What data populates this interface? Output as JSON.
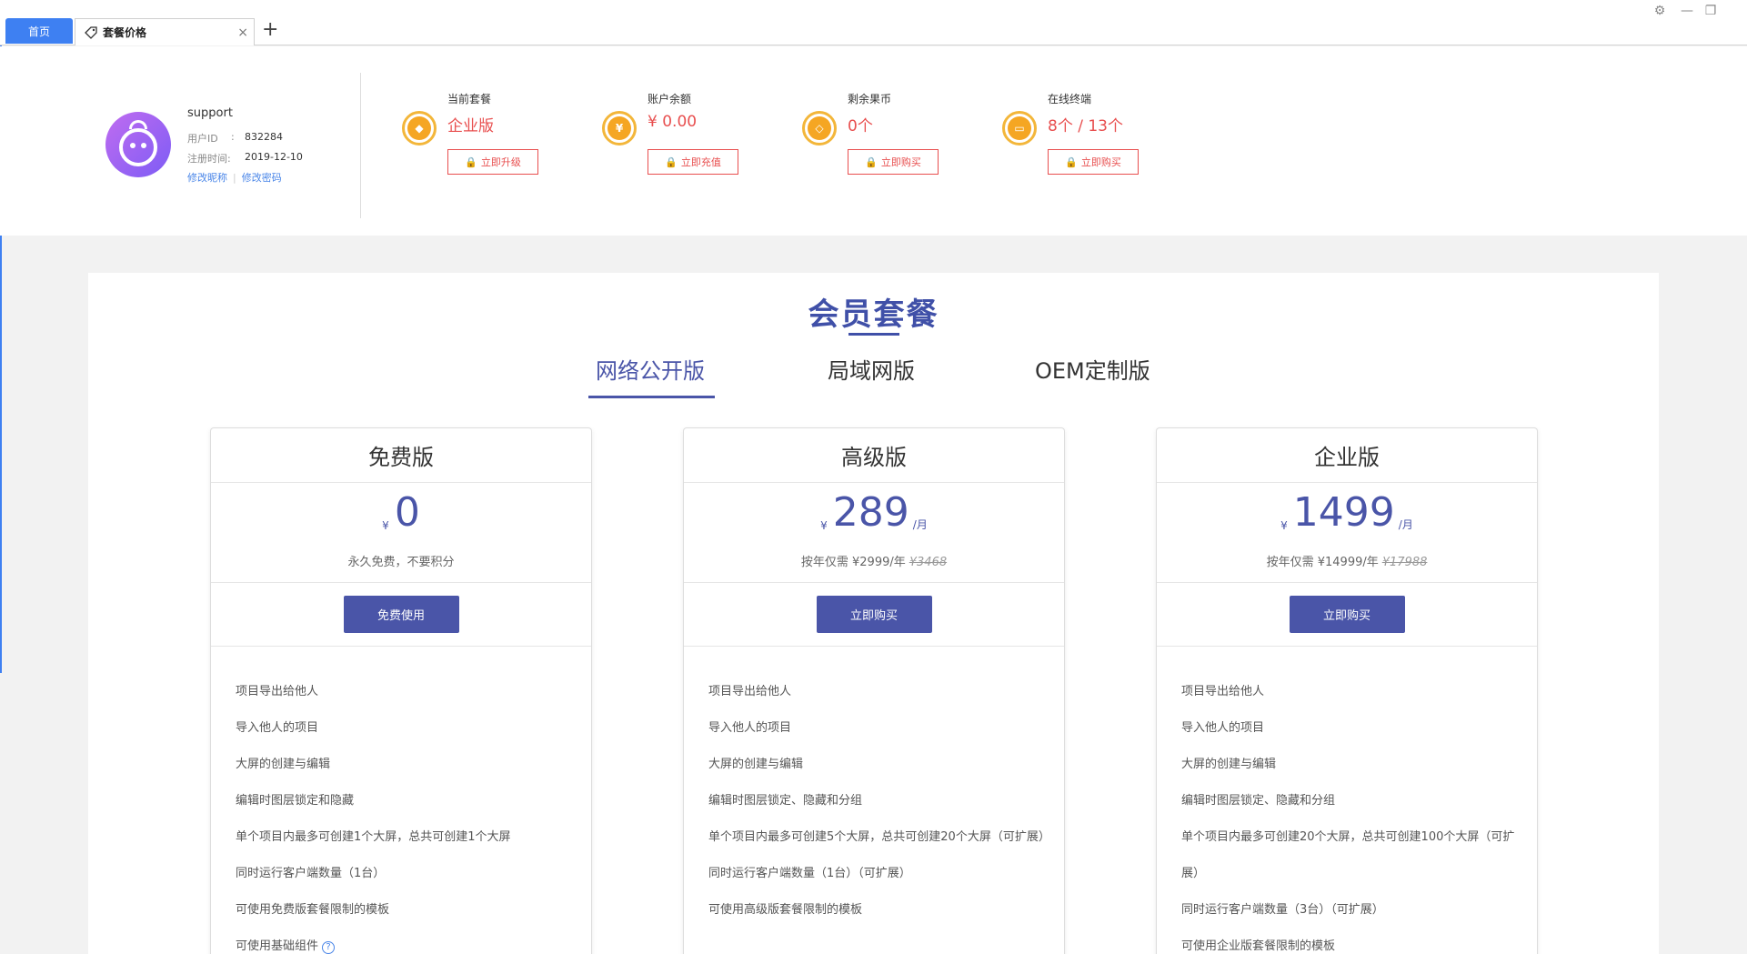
{
  "tabs": {
    "home": "首页",
    "active": "套餐价格",
    "close": "×",
    "add": "+"
  },
  "window": {
    "settings": "⚙",
    "restore": "❐",
    "minimize": "—"
  },
  "user": {
    "name": "support",
    "id_label": "用户ID",
    "id_sep": ":",
    "id_value": "832284",
    "reg_label": "注册时间:",
    "reg_value": "2019-12-10",
    "edit_nick": "修改昵称",
    "sep": "|",
    "edit_pwd": "修改密码"
  },
  "stats": [
    {
      "label": "当前套餐",
      "value": "企业版",
      "button": "立即升级",
      "icon": "diamond-icon"
    },
    {
      "label": "账户余额",
      "value": "¥ 0.00",
      "button": "立即充值",
      "icon": "money-bag-icon"
    },
    {
      "label": "剩余果币",
      "value": "0个",
      "button": "立即购买",
      "icon": "coin-icon"
    },
    {
      "label": "在线终端",
      "value": "8个 / 13个",
      "button": "立即购买",
      "icon": "monitor-icon"
    }
  ],
  "main": {
    "title": "会员套餐",
    "tabs": [
      "网络公开版",
      "局域网版",
      "OEM定制版"
    ],
    "active_tab": 0
  },
  "plans": [
    {
      "title": "免费版",
      "currency": "¥",
      "price": "0",
      "per": "",
      "sub": "永久免费，不要积分",
      "orig": "",
      "button": "免费使用",
      "features": [
        "项目导出给他人",
        "导入他人的项目",
        "大屏的创建与编辑",
        "编辑时图层锁定和隐藏",
        "单个项目内最多可创建1个大屏，总共可创建1个大屏",
        "同时运行客户端数量（1台）",
        "可使用免费版套餐限制的模板",
        "可使用基础组件"
      ]
    },
    {
      "title": "高级版",
      "currency": "¥",
      "price": "289",
      "per": "/月",
      "sub": "按年仅需 ¥2999/年",
      "orig": "¥3468",
      "button": "立即购买",
      "features": [
        "项目导出给他人",
        "导入他人的项目",
        "大屏的创建与编辑",
        "编辑时图层锁定、隐藏和分组",
        "单个项目内最多可创建5个大屏，总共可创建20个大屏（可扩展）",
        "同时运行客户端数量（1台）（可扩展）",
        "可使用高级版套餐限制的模板"
      ]
    },
    {
      "title": "企业版",
      "currency": "¥",
      "price": "1499",
      "per": "/月",
      "sub": "按年仅需 ¥14999/年",
      "orig": "¥17988",
      "button": "立即购买",
      "features": [
        "项目导出给他人",
        "导入他人的项目",
        "大屏的创建与编辑",
        "编辑时图层锁定、隐藏和分组",
        "单个项目内最多可创建20个大屏，总共可创建100个大屏（可扩展）",
        "同时运行客户端数量（3台）（可扩展）",
        "可使用企业版套餐限制的模板"
      ]
    }
  ],
  "colors": {
    "accent": "#4a55a8",
    "tab_blue": "#3e80f2",
    "red": "#e84f4f",
    "gold": "#f5a623"
  }
}
